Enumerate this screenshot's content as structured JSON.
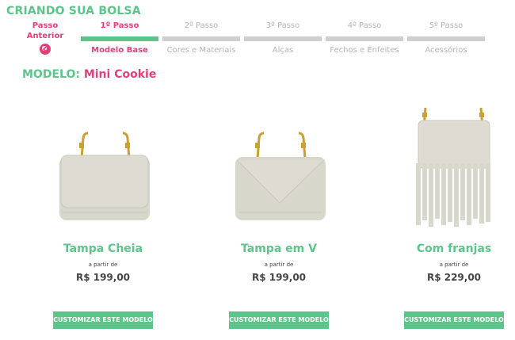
{
  "page_title": "CRIANDO SUA BOLSA",
  "prev_step": {
    "line1": "Passo",
    "line2": "Anterior"
  },
  "steps": [
    {
      "num": "1º Passo",
      "name": "Modelo Base"
    },
    {
      "num": "2º Passo",
      "name": "Cores e Materiais"
    },
    {
      "num": "3º Passo",
      "name": "Alças"
    },
    {
      "num": "4º Passo",
      "name": "Fechos e Enfeites"
    },
    {
      "num": "5º Passo",
      "name": "Acessórios"
    }
  ],
  "model": {
    "label": "MODELO:",
    "name": "Mini Cookie"
  },
  "products": [
    {
      "name": "Tampa Cheia",
      "price_prefix": "a partir de",
      "price": "R$ 199,00",
      "button": "CUSTOMIZAR ESTE MODELO"
    },
    {
      "name": "Tampa em V",
      "price_prefix": "a partir de",
      "price": "R$ 199,00",
      "button": "CUSTOMIZAR ESTE MODELO"
    },
    {
      "name": "Com franjas",
      "price_prefix": "a partir de",
      "price": "R$ 229,00",
      "button": "CUSTOMIZAR ESTE MODELO"
    }
  ],
  "colors": {
    "green": "#5dc48a",
    "pink": "#e0407a",
    "bag": "#d8d7cc",
    "gold": "#c9a033"
  }
}
